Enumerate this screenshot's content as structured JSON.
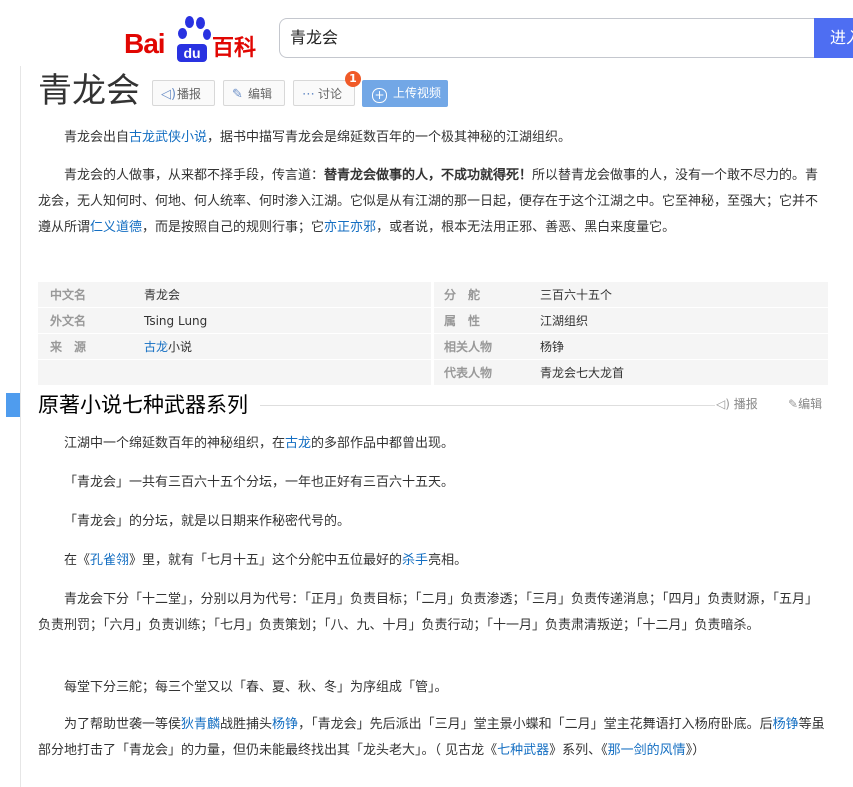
{
  "header": {
    "logo_bai": "Bai",
    "logo_du": "du",
    "logo_baike": "百科",
    "search_value": "青龙会",
    "search_button": "进入"
  },
  "title": {
    "text": "青龙会",
    "listen": "播报",
    "edit": "编辑",
    "discuss": "讨论",
    "discuss_count": "1",
    "upload": "上传视频"
  },
  "intro": {
    "p1_a": "青龙会出自",
    "p1_link": "古龙武侠小说",
    "p1_b": "，据书中描写青龙会是绵延数百年的一个极其神秘的江湖组织。",
    "p2_a": "青龙会的人做事，从来都不择手段，传言道：",
    "p2_bold": "替青龙会做事的人，不成功就得死！",
    "p2_b": "所以替青龙会做事的人，没有一个敢不尽力的。青龙会，无人知何时、何地、何人统率、何时渗入江湖。它似是从有江湖的那一日起，便存在于这个江湖之中。它至神秘，至强大；它并不遵从所谓",
    "p2_link1": "仁义道德",
    "p2_c": "，而是按照自己的规则行事；它",
    "p2_link2": "亦正亦邪",
    "p2_d": "，或者说，根本无法用正邪、善恶、黑白来度量它。"
  },
  "basic_info": {
    "left": [
      {
        "key": "中文名",
        "value": "青龙会"
      },
      {
        "key": "外文名",
        "value": "Tsing Lung"
      },
      {
        "key": "来　源",
        "value_link": "古龙",
        "value": "小说"
      }
    ],
    "right": [
      {
        "key": "分　舵",
        "value": "三百六十五个"
      },
      {
        "key": "属　性",
        "value": "江湖组织"
      },
      {
        "key": "相关人物",
        "value_link": "杨铮"
      },
      {
        "key": "代表人物",
        "value": "青龙会七大龙首"
      }
    ]
  },
  "section": {
    "title": "原著小说七种武器系列",
    "listen": "播报",
    "edit": "编辑"
  },
  "body": {
    "s1_a": "江湖中一个绵延数百年的神秘组织，在",
    "s1_link": "古龙",
    "s1_b": "的多部作品中都曾出现。",
    "s2": "「青龙会」一共有三百六十五个分坛，一年也正好有三百六十五天。",
    "s3": "「青龙会」的分坛，就是以日期来作秘密代号的。",
    "s4_a": "在《",
    "s4_link1": "孔雀翎",
    "s4_b": "》里，就有「七月十五」这个分舵中五位最好的",
    "s4_link2": "杀手",
    "s4_c": "亮相。",
    "s5": "青龙会下分「十二堂」，分别以月为代号：「正月」负责目标；「二月」负责渗透；「三月」负责传递消息；「四月」负责财源，「五月」负责刑罚；「六月」负责训练；「七月」负责策划；「八、九、十月」负责行动；「十一月」负责肃清叛逆；「十二月」负责暗杀。",
    "s6": "每堂下分三舵；每三个堂又以「春、夏、秋、冬」为序组成「管」。",
    "s7_a": "为了帮助世袭一等侯",
    "s7_link1": "狄青麟",
    "s7_b": "战胜捕头",
    "s7_link2": "杨铮",
    "s7_c": "，「青龙会」先后派出「三月」堂主景小蝶和「二月」堂主花舞语打入杨府卧底。后",
    "s7_link3": "杨铮",
    "s7_d": "等虽部分地打击了「青龙会」的力量，但仍未能最终找出其「龙头老大」。（ 见古龙《",
    "s7_link4": "七种武器",
    "s7_e": "》系列、《",
    "s7_link5": "那一剑的风情",
    "s7_f": "》）"
  }
}
